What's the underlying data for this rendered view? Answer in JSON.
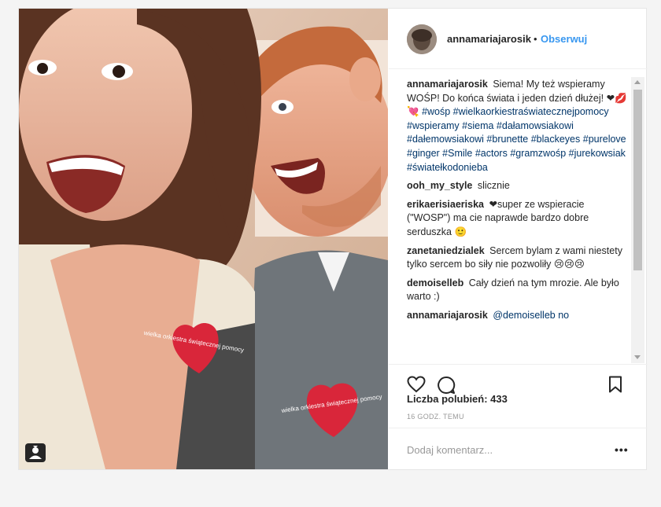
{
  "post": {
    "username": "annamariajarosik",
    "separator": "•",
    "follow_label": "Obserwuj",
    "likes_text": "Liczba polubień: 433",
    "time_text": "16 GODZ. TEMU",
    "comment_placeholder": "Dodaj komentarz...",
    "more_label": "•••",
    "sticker_text_1": "wielka orkiestra świątecznej pomocy",
    "sticker_text_2": "wielka orkiestra świątecznej pomocy"
  },
  "caption": {
    "author": "annamariajarosik",
    "text": "Siema! My też wspieramy WOŚP! Do końca świata i jeden dzień dłużej! ❤💋💘",
    "hashtags": "#wośp #wielkaorkiestraświatecznejpomocy #wspieramy #siema #dałamowsiakowi #dałemowsiakowi #brunette #blackeyes #purelove #ginger #Smile #actors #gramzwośp #jurekowsiak #światełkodonieba"
  },
  "comments": [
    {
      "author": "ooh_my_style",
      "text": "slicznie"
    },
    {
      "author": "erikaerisiaeriska",
      "text": "❤super ze wspieracie (\"WOSP\") ma cie naprawde bardzo dobre serduszka 🙂"
    },
    {
      "author": "zanetaniedzialek",
      "text": "Sercem bylam z wami niestety tylko sercem bo siły nie pozwoliły 😢😢😢"
    },
    {
      "author": "demoiselleb",
      "text": "Cały dzień na tym mrozie. Ale było warto :)"
    },
    {
      "author": "annamariajarosik",
      "text": "@demoiselleb no"
    }
  ],
  "icons": {
    "like": "heart-icon",
    "comment": "comment-icon",
    "save": "bookmark-icon",
    "tag": "user-tag-icon"
  },
  "colors": {
    "link": "#003569",
    "follow": "#3897f0",
    "sticker": "#d9263a"
  }
}
